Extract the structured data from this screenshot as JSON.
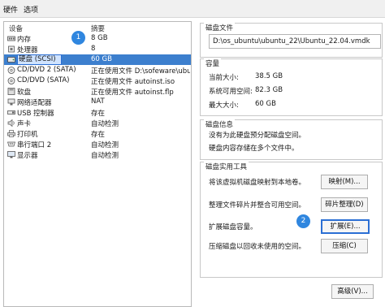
{
  "tabs": [
    "硬件",
    "选项"
  ],
  "device_list": {
    "header_device": "设备",
    "header_summary": "摘要",
    "rows": [
      {
        "device": "内存",
        "summary": "8 GB",
        "icon": "memory-icon"
      },
      {
        "device": "处理器",
        "summary": "8",
        "icon": "cpu-icon"
      },
      {
        "device": "硬盘 (SCSI)",
        "summary": "60 GB",
        "icon": "harddisk-icon",
        "selected": true
      },
      {
        "device": "CD/DVD 2 (SATA)",
        "summary": "正在使用文件 D:\\sofeware\\ubu...",
        "icon": "cd-icon"
      },
      {
        "device": "CD/DVD (SATA)",
        "summary": "正在使用文件 autoinst.iso",
        "icon": "cd-icon"
      },
      {
        "device": "软盘",
        "summary": "正在使用文件 autoinst.flp",
        "icon": "floppy-icon"
      },
      {
        "device": "网络适配器",
        "summary": "NAT",
        "icon": "network-icon"
      },
      {
        "device": "USB 控制器",
        "summary": "存在",
        "icon": "usb-icon"
      },
      {
        "device": "声卡",
        "summary": "自动检测",
        "icon": "sound-icon"
      },
      {
        "device": "打印机",
        "summary": "存在",
        "icon": "printer-icon"
      },
      {
        "device": "串行端口 2",
        "summary": "自动检测",
        "icon": "serial-icon"
      },
      {
        "device": "显示器",
        "summary": "自动检测",
        "icon": "display-icon"
      }
    ]
  },
  "badges": {
    "one": "1",
    "two": "2"
  },
  "disk_file": {
    "title": "磁盘文件",
    "path": "D:\\os_ubuntu\\ubuntu_22\\Ubuntu_22.04.vmdk"
  },
  "capacity": {
    "title": "容量",
    "current_label": "当前大小:",
    "current_value": "38.5 GB",
    "system_free_label": "系统可用空间:",
    "system_free_value": "82.3 GB",
    "max_label": "最大大小:",
    "max_value": "60 GB"
  },
  "disk_info": {
    "title": "磁盘信息",
    "line1": "没有为此硬盘预分配磁盘空间。",
    "line2": "硬盘内容存储在多个文件中。"
  },
  "disk_utils": {
    "title": "磁盘实用工具",
    "map_desc": "将该虚拟机磁盘映射到本地卷。",
    "map_btn": "映射(M)...",
    "defrag_desc": "整理文件碎片并整合可用空间。",
    "defrag_btn": "碎片整理(D)",
    "expand_desc": "扩展磁盘容量。",
    "expand_btn": "扩展(E)...",
    "compact_desc": "压缩磁盘以回收未使用的空间。",
    "compact_btn": "压缩(C)"
  },
  "advanced_btn": "高级(V)...",
  "colors": {
    "selection": "#3c7fce",
    "badge": "#2f86df",
    "focus_border": "#2b6fd4"
  }
}
